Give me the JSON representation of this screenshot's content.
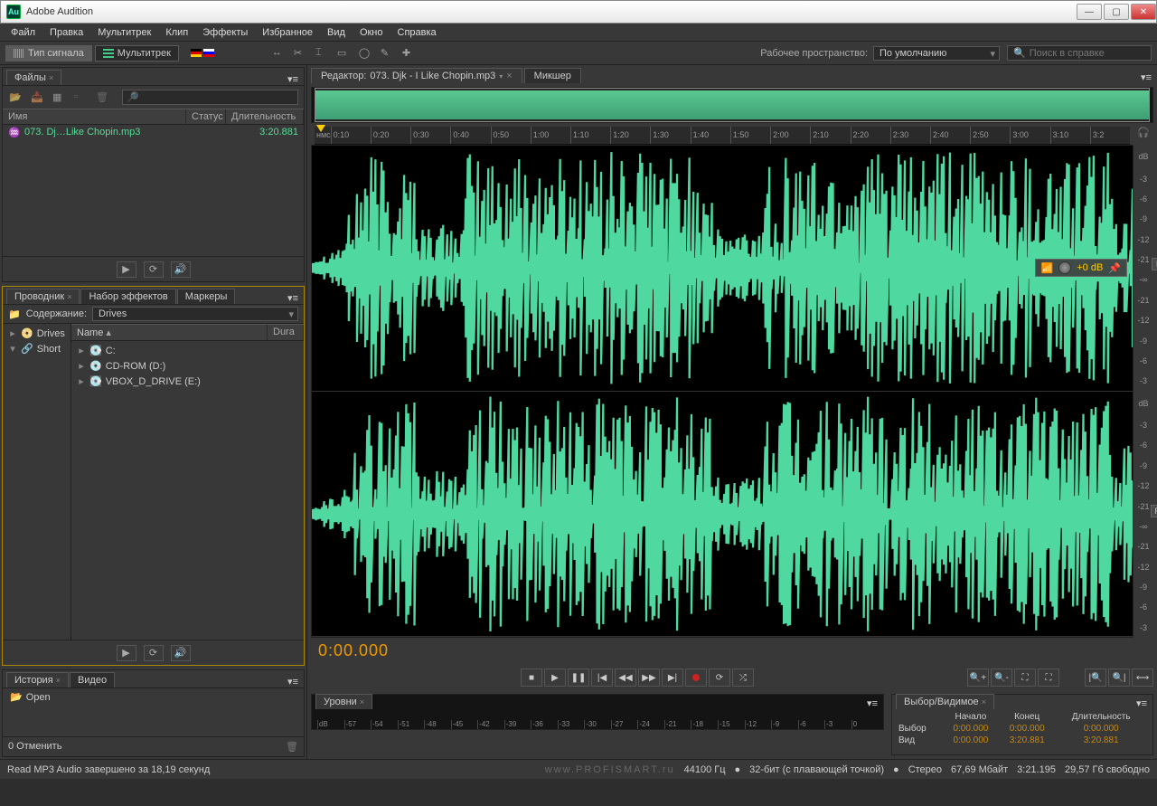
{
  "app": {
    "title": "Adobe Audition",
    "logo": "Au"
  },
  "window_buttons": {
    "min": "—",
    "max": "▢",
    "close": "✕"
  },
  "menus": [
    "Файл",
    "Правка",
    "Мультитрек",
    "Клип",
    "Эффекты",
    "Избранное",
    "Вид",
    "Окно",
    "Справка"
  ],
  "modes": {
    "waveform": "Тип сигнала",
    "multitrack": "Мультитрек"
  },
  "workspace": {
    "label": "Рабочее пространство:",
    "value": "По умолчанию"
  },
  "search": {
    "placeholder": "Поиск в справке",
    "icon": "🔍"
  },
  "files_panel": {
    "tab": "Файлы",
    "cols": {
      "name": "Имя",
      "status": "Статус",
      "duration": "Длительность"
    },
    "items": [
      {
        "name": "073. Dj…Like Chopin.mp3",
        "duration": "3:20.881"
      }
    ]
  },
  "explorer_panel": {
    "tabs": [
      "Проводник",
      "Набор эффектов",
      "Маркеры"
    ],
    "content_label": "Содержание:",
    "content_value": "Drives",
    "left_items": [
      "Drives",
      "Short"
    ],
    "cols": {
      "name": "Name",
      "dura": "Dura"
    },
    "drives": [
      "C:",
      "CD-ROM (D:)",
      "VBOX_D_DRIVE (E:)"
    ]
  },
  "history_panel": {
    "tabs": [
      "История",
      "Видео"
    ],
    "items": [
      "Open"
    ],
    "undo": "0 Отменить"
  },
  "editor": {
    "tab_prefix": "Редактор:",
    "filename": "073. Djk - I Like Chopin.mp3",
    "mixer_tab": "Микшер",
    "ruler_unit": "нмс",
    "ticks": [
      "0:10",
      "0:20",
      "0:30",
      "0:40",
      "0:50",
      "1:00",
      "1:10",
      "1:20",
      "1:30",
      "1:40",
      "1:50",
      "2:00",
      "2:10",
      "2:20",
      "2:30",
      "2:40",
      "2:50",
      "3:00",
      "3:10",
      "3:2"
    ],
    "db_label": "dB",
    "db_vals": [
      "-3",
      "-6",
      "-9",
      "-12",
      "-21",
      "-∞",
      "-21",
      "-12",
      "-9",
      "-6",
      "-3"
    ],
    "ch": {
      "l": "L",
      "r": "R"
    },
    "overlay_db": "+0 dB",
    "bigtime": "0:00.000"
  },
  "levels": {
    "tab": "Уровни",
    "ticks": [
      "dB",
      "-57",
      "-54",
      "-51",
      "-48",
      "-45",
      "-42",
      "-39",
      "-36",
      "-33",
      "-30",
      "-27",
      "-24",
      "-21",
      "-18",
      "-15",
      "-12",
      "-9",
      "-6",
      "-3",
      "0"
    ]
  },
  "selection": {
    "tab": "Выбор/Видимое",
    "headers": [
      "Начало",
      "Конец",
      "Длительность"
    ],
    "rows": [
      {
        "label": "Выбор",
        "start": "0:00.000",
        "end": "0:00.000",
        "dur": "0:00.000"
      },
      {
        "label": "Вид",
        "start": "0:00.000",
        "end": "3:20.881",
        "dur": "3:20.881"
      }
    ]
  },
  "status": {
    "left": "Read MP3 Audio завершено за 18,19 секунд",
    "sample": "44100 Гц",
    "bit": "32-бит (с плавающей точкой)",
    "ch": "Стерео",
    "size": "67,69 Мбайт",
    "dur": "3:21.195",
    "disk": "29,57 Гб свободно",
    "watermark": "www.PROFISMART.ru"
  }
}
